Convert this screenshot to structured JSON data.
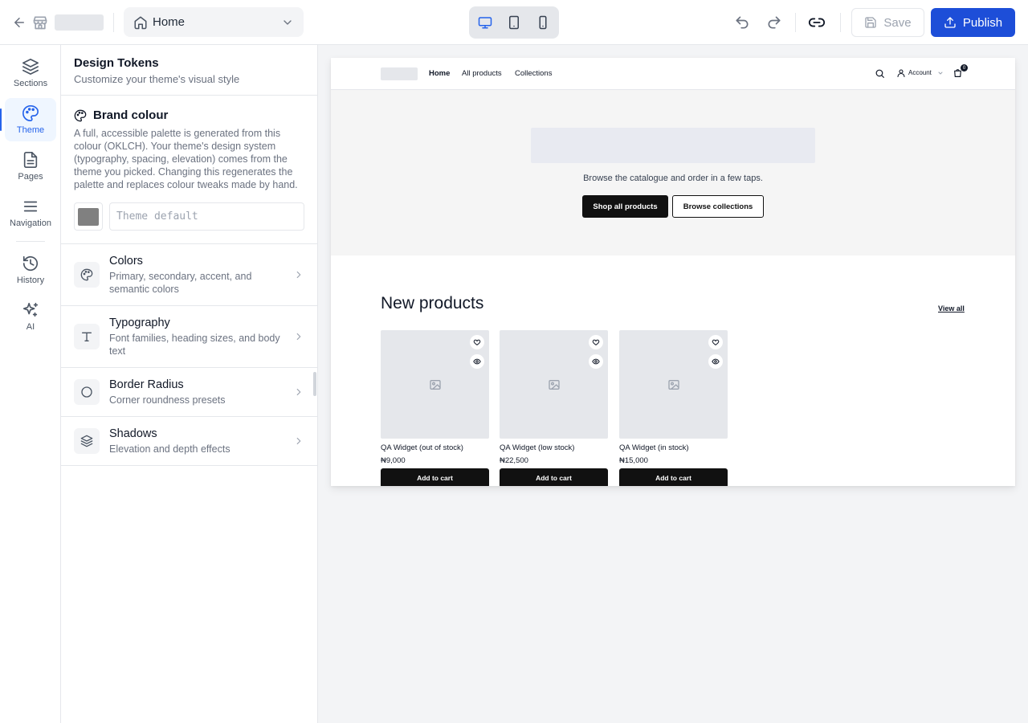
{
  "topbar": {
    "page_select_label": "Home",
    "save_label": "Save",
    "publish_label": "Publish"
  },
  "rail": {
    "items": [
      {
        "label": "Sections",
        "icon": "layers-icon"
      },
      {
        "label": "Theme",
        "icon": "palette-icon",
        "active": true
      },
      {
        "label": "Pages",
        "icon": "document-icon"
      },
      {
        "label": "Navigation",
        "icon": "menu-icon"
      },
      {
        "label": "History",
        "icon": "history-icon"
      },
      {
        "label": "AI",
        "icon": "sparkle-icon"
      }
    ]
  },
  "panel": {
    "title": "Design Tokens",
    "subtitle": "Customize your theme's visual style",
    "brand": {
      "title": "Brand colour",
      "description": "A full, accessible palette is generated from this colour (OKLCH). Your theme's design system (typography, spacing, elevation) comes from the theme you picked. Changing this regenerates the palette and replaces colour tweaks made by hand.",
      "input_placeholder": "Theme default",
      "swatch_color": "#808080"
    },
    "tokens": [
      {
        "title": "Colors",
        "subtitle": "Primary, secondary, accent, and semantic colors",
        "icon": "palette-icon"
      },
      {
        "title": "Typography",
        "subtitle": "Font families, heading sizes, and body text",
        "icon": "type-icon"
      },
      {
        "title": "Border Radius",
        "subtitle": "Corner roundness presets",
        "icon": "circle-icon"
      },
      {
        "title": "Shadows",
        "subtitle": "Elevation and depth effects",
        "icon": "layers-icon"
      }
    ]
  },
  "storefront": {
    "nav": [
      "Home",
      "All products",
      "Collections"
    ],
    "account_label": "Account",
    "cart_count": "0",
    "hero_subtitle": "Browse the catalogue and order in a few taps.",
    "hero_primary": "Shop all products",
    "hero_secondary": "Browse collections",
    "section_title": "New products",
    "view_all": "View all",
    "products": [
      {
        "name": "QA Widget (out of stock)",
        "price": "₦9,000",
        "cta": "Add to cart"
      },
      {
        "name": "QA Widget (low stock)",
        "price": "₦22,500",
        "cta": "Add to cart"
      },
      {
        "name": "QA Widget (in stock)",
        "price": "₦15,000",
        "cta": "Add to cart"
      }
    ]
  },
  "colors": {
    "accent": "#1d4ed8",
    "active_rail": "#2563eb",
    "canvas_bg": "#f3f4f6"
  }
}
